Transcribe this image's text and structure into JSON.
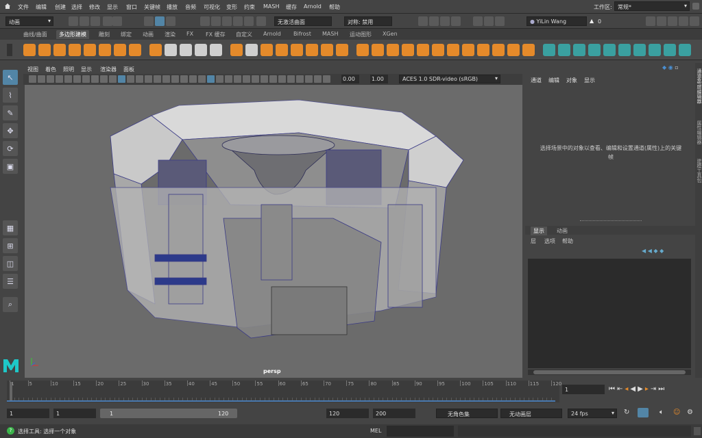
{
  "menubar": {
    "items": [
      "文件",
      "编辑",
      "创建",
      "选择",
      "修改",
      "显示",
      "窗口",
      "关键帧",
      "播放",
      "音频",
      "可视化",
      "变形",
      "约束",
      "MASH",
      "缓存",
      "Arnold",
      "帮助"
    ],
    "workspace_label": "工作区:",
    "workspace_value": "常规*"
  },
  "statusline": {
    "mode_menu": "动画",
    "live_surface": "无激活曲面",
    "symmetry": "对称: 禁用",
    "user": "YiLin Wang",
    "notifications": "0"
  },
  "shelf": {
    "tabs": [
      "曲线/曲面",
      "多边形建模",
      "雕刻",
      "绑定",
      "动画",
      "渲染",
      "FX",
      "FX 缓存",
      "自定义",
      "Arnold",
      "Bifrost",
      "MASH",
      "运动图形",
      "XGen"
    ],
    "active_tab": "多边形建模"
  },
  "viewport": {
    "menus": [
      "视图",
      "着色",
      "照明",
      "显示",
      "渲染器",
      "面板"
    ],
    "camera_label": "persp",
    "exposure": "0.00",
    "gamma": "1.00",
    "color_space": "ACES 1.0 SDR-video (sRGB)"
  },
  "channel_box": {
    "tabs": [
      "通道",
      "编辑",
      "对象",
      "显示"
    ],
    "empty_message": "选择场景中的对象以查看、编辑和设置通道(属性)上的关键帧"
  },
  "layer_editor": {
    "tabs": [
      "显示",
      "动画"
    ],
    "menus": [
      "层",
      "选项",
      "帮助"
    ]
  },
  "side_tabs": [
    "通道盒/层编辑器",
    "属性编辑器",
    "建模工具包"
  ],
  "timeline": {
    "ticks": [
      "1",
      "5",
      "10",
      "15",
      "20",
      "25",
      "30",
      "35",
      "40",
      "45",
      "50",
      "55",
      "60",
      "65",
      "70",
      "75",
      "80",
      "85",
      "90",
      "95",
      "100",
      "105",
      "110",
      "115",
      "120"
    ],
    "current_frame": "1"
  },
  "range": {
    "start": "1",
    "playback_start": "1",
    "slider_start": "1",
    "slider_end": "120",
    "playback_end": "120",
    "end": "200",
    "character_set": "无角色集",
    "anim_layer": "无动画层",
    "fps": "24 fps"
  },
  "helpline": {
    "message": "选择工具: 选择一个对象",
    "mel_label": "MEL"
  },
  "colors": {
    "accent_orange": "#e58a2a",
    "select_blue": "#5285a6",
    "maya_logo": "#1ec8c8"
  }
}
